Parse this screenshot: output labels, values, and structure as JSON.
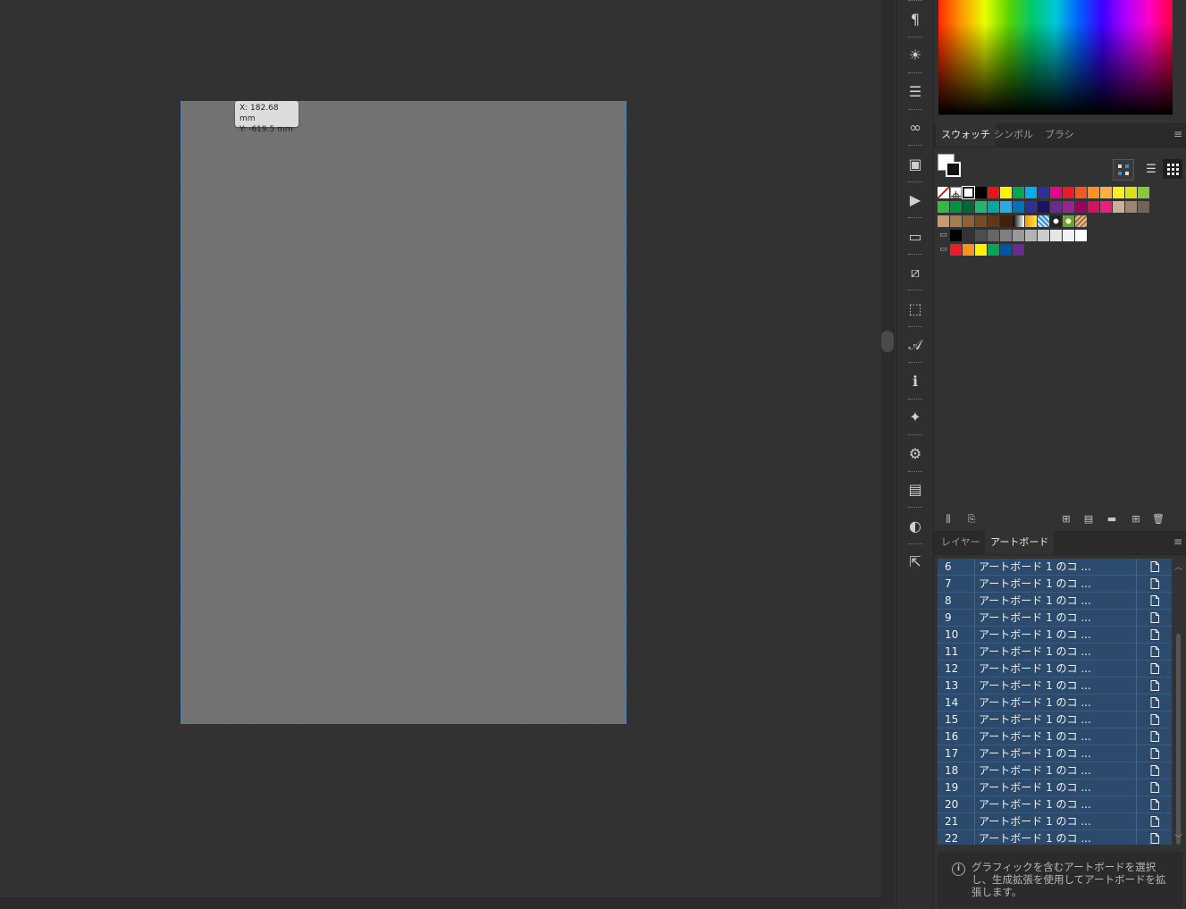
{
  "canvas": {
    "coord_x": "X: 182.68 mm",
    "coord_y": "Y: -619.5 mm"
  },
  "icon_strip": [
    {
      "name": "paragraph-icon",
      "glyph": "¶"
    },
    {
      "name": "appearance-icon",
      "glyph": "☀"
    },
    {
      "name": "align-icon",
      "glyph": "☰"
    },
    {
      "name": "links-icon",
      "glyph": "∞"
    },
    {
      "name": "pathfinder-icon",
      "glyph": "▣"
    },
    {
      "name": "actions-play-icon",
      "glyph": "▶"
    },
    {
      "name": "gradient-icon",
      "glyph": "▭"
    },
    {
      "name": "image-trace-icon",
      "glyph": "⧄"
    },
    {
      "name": "asset-export-icon",
      "glyph": "⬚"
    },
    {
      "name": "glyphs-icon",
      "glyph": "𝒜"
    },
    {
      "name": "info-icon",
      "glyph": "ℹ"
    },
    {
      "name": "magic-wand-icon",
      "glyph": "✦"
    },
    {
      "name": "properties-gear-icon",
      "glyph": "⚙"
    },
    {
      "name": "artboards-panel-icon",
      "glyph": "▤"
    },
    {
      "name": "color-guide-icon",
      "glyph": "◐"
    },
    {
      "name": "export-icon",
      "glyph": "⇱"
    }
  ],
  "swatch_panel": {
    "tabs": [
      "スウォッチ",
      "シンボル",
      "ブラシ"
    ],
    "active_tab": 0,
    "rows": [
      [
        "none",
        "#ffffff|reg",
        "#ffffff|sel",
        "#000000",
        "#e8141c",
        "#fff200",
        "#00a651",
        "#00aeef",
        "#2e3192",
        "#ec008c",
        "#ed1c24",
        "#f15a24",
        "#f7931e",
        "#fbb03b",
        "#fcee21",
        "#d9e021",
        "#8cc63f"
      ],
      [
        "#39b54a",
        "#009245",
        "#006837",
        "#22b573",
        "#00a99d",
        "#29abe2",
        "#0071bc",
        "#2e3192",
        "#1b1464",
        "#662d91",
        "#93278f",
        "#9e005d",
        "#d4145a",
        "#ed1e79",
        "#c7b299",
        "#998675",
        "#736357"
      ],
      [
        "#c69c6d",
        "#a67c52",
        "#8c6239",
        "#754c24",
        "#603813",
        "#42210b",
        "grad:#000,#fff",
        "grad:#f7931e,#fcee21",
        "pattern-blue",
        "pattern-dot",
        "pattern-leaf",
        "pattern-brown"
      ],
      [
        "folder",
        "#000000",
        "#333333",
        "#4d4d4d",
        "#666666",
        "#808080",
        "#999999",
        "#b3b3b3",
        "#cccccc",
        "#e6e6e6",
        "#f2f2f2",
        "#ffffff"
      ],
      [
        "folder",
        "#ed1c24",
        "#f7931e",
        "#fff200",
        "#00a651",
        "#0054a6",
        "#662d91"
      ]
    ]
  },
  "artboard_panel": {
    "tabs": [
      "レイヤー",
      "アートボード"
    ],
    "active_tab": 1,
    "rows": [
      {
        "num": "6",
        "name": "アートボード 1 のコ ..."
      },
      {
        "num": "7",
        "name": "アートボード 1 のコ ..."
      },
      {
        "num": "8",
        "name": "アートボード 1 のコ ..."
      },
      {
        "num": "9",
        "name": "アートボード 1 のコ ..."
      },
      {
        "num": "10",
        "name": "アートボード 1 のコ ..."
      },
      {
        "num": "11",
        "name": "アートボード 1 のコ ..."
      },
      {
        "num": "12",
        "name": "アートボード 1 のコ ..."
      },
      {
        "num": "13",
        "name": "アートボード 1 のコ ..."
      },
      {
        "num": "14",
        "name": "アートボード 1 のコ ..."
      },
      {
        "num": "15",
        "name": "アートボード 1 のコ ..."
      },
      {
        "num": "16",
        "name": "アートボード 1 のコ ..."
      },
      {
        "num": "17",
        "name": "アートボード 1 のコ ..."
      },
      {
        "num": "18",
        "name": "アートボード 1 のコ ..."
      },
      {
        "num": "19",
        "name": "アートボード 1 のコ ..."
      },
      {
        "num": "20",
        "name": "アートボード 1 のコ ..."
      },
      {
        "num": "21",
        "name": "アートボード 1 のコ ..."
      },
      {
        "num": "22",
        "name": "アートボード 1 のコ ..."
      }
    ],
    "row_icon": "artboard-options-icon",
    "selected_color": "#2c4a6c"
  },
  "info_message": {
    "text": "グラフィックを含むアートボードを選択し、生成拡張を使用してアートボードを拡張します。",
    "icon": "info-circle-icon"
  }
}
